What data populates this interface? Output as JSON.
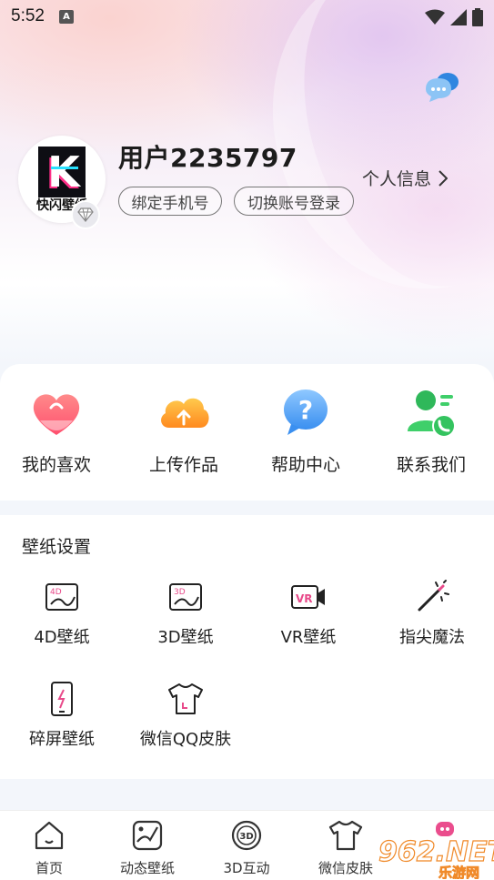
{
  "status_bar": {
    "time": "5:52",
    "notification_badge": "A",
    "icons": [
      "wifi-icon",
      "signal-icon",
      "battery-icon"
    ]
  },
  "profile": {
    "avatar_text": "快闪壁纸",
    "avatar_logo_letter": "K",
    "username": "用户2235797",
    "bind_phone_label": "绑定手机号",
    "switch_account_label": "切换账号登录",
    "profile_link_label": "个人信息"
  },
  "quick_actions": [
    {
      "label": "我的喜欢",
      "icon": "heart-icon"
    },
    {
      "label": "上传作品",
      "icon": "cloud-upload-icon"
    },
    {
      "label": "帮助中心",
      "icon": "help-bubble-icon"
    },
    {
      "label": "联系我们",
      "icon": "contact-user-icon"
    }
  ],
  "wallpaper_settings": {
    "title": "壁纸设置",
    "items": [
      {
        "label": "4D壁纸",
        "icon": "4d-wallpaper-icon",
        "badge": "4D"
      },
      {
        "label": "3D壁纸",
        "icon": "3d-wallpaper-icon",
        "badge": "3D"
      },
      {
        "label": "VR壁纸",
        "icon": "vr-camera-icon",
        "badge": "VR"
      },
      {
        "label": "指尖魔法",
        "icon": "magic-wand-icon"
      },
      {
        "label": "碎屏壁纸",
        "icon": "broken-phone-icon"
      },
      {
        "label": "微信QQ皮肤",
        "icon": "shirt-icon"
      }
    ]
  },
  "tab_bar": [
    {
      "label": "首页",
      "icon": "home-icon"
    },
    {
      "label": "动态壁纸",
      "icon": "dynamic-wallpaper-icon"
    },
    {
      "label": "3D互动",
      "icon": "3d-interact-icon",
      "badge": "3D"
    },
    {
      "label": "微信皮肤",
      "icon": "shirt-icon"
    }
  ],
  "watermark": {
    "text": "962.NET",
    "subtext": "乐游网"
  },
  "colors": {
    "accent_pink": "#e84a8a",
    "text_dark": "#222222",
    "pill_border": "#777777"
  }
}
